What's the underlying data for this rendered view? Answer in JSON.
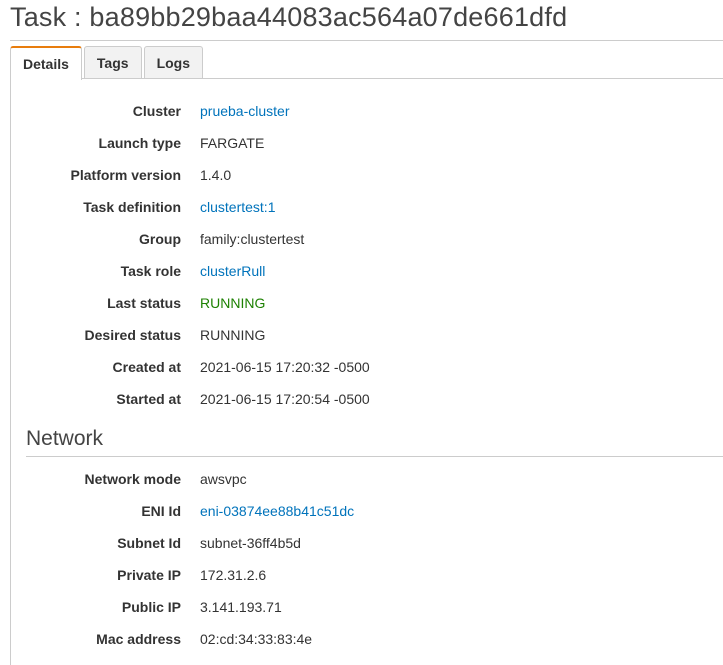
{
  "title": "Task : ba89bb29baa44083ac564a07de661dfd",
  "tabs": [
    {
      "label": "Details"
    },
    {
      "label": "Tags"
    },
    {
      "label": "Logs"
    }
  ],
  "details": [
    {
      "key": "Cluster",
      "value": "prueba-cluster"
    },
    {
      "key": "Launch type",
      "value": "FARGATE"
    },
    {
      "key": "Platform version",
      "value": "1.4.0"
    },
    {
      "key": "Task definition",
      "value": "clustertest:1"
    },
    {
      "key": "Group",
      "value": "family:clustertest"
    },
    {
      "key": "Task role",
      "value": "clusterRull"
    },
    {
      "key": "Last status",
      "value": "RUNNING"
    },
    {
      "key": "Desired status",
      "value": "RUNNING"
    },
    {
      "key": "Created at",
      "value": "2021-06-15 17:20:32 -0500"
    },
    {
      "key": "Started at",
      "value": "2021-06-15 17:20:54 -0500"
    }
  ],
  "network": {
    "title": "Network",
    "rows": [
      {
        "key": "Network mode",
        "value": "awsvpc"
      },
      {
        "key": "ENI Id",
        "value": "eni-03874ee88b41c51dc"
      },
      {
        "key": "Subnet Id",
        "value": "subnet-36ff4b5d"
      },
      {
        "key": "Private IP",
        "value": "172.31.2.6"
      },
      {
        "key": "Public IP",
        "value": "3.141.193.71"
      },
      {
        "key": "Mac address",
        "value": "02:cd:34:33:83:4e"
      }
    ]
  },
  "colors": {
    "link": "#0073bb",
    "running": "#1d8102",
    "active_tab_accent": "#e87d0d"
  }
}
